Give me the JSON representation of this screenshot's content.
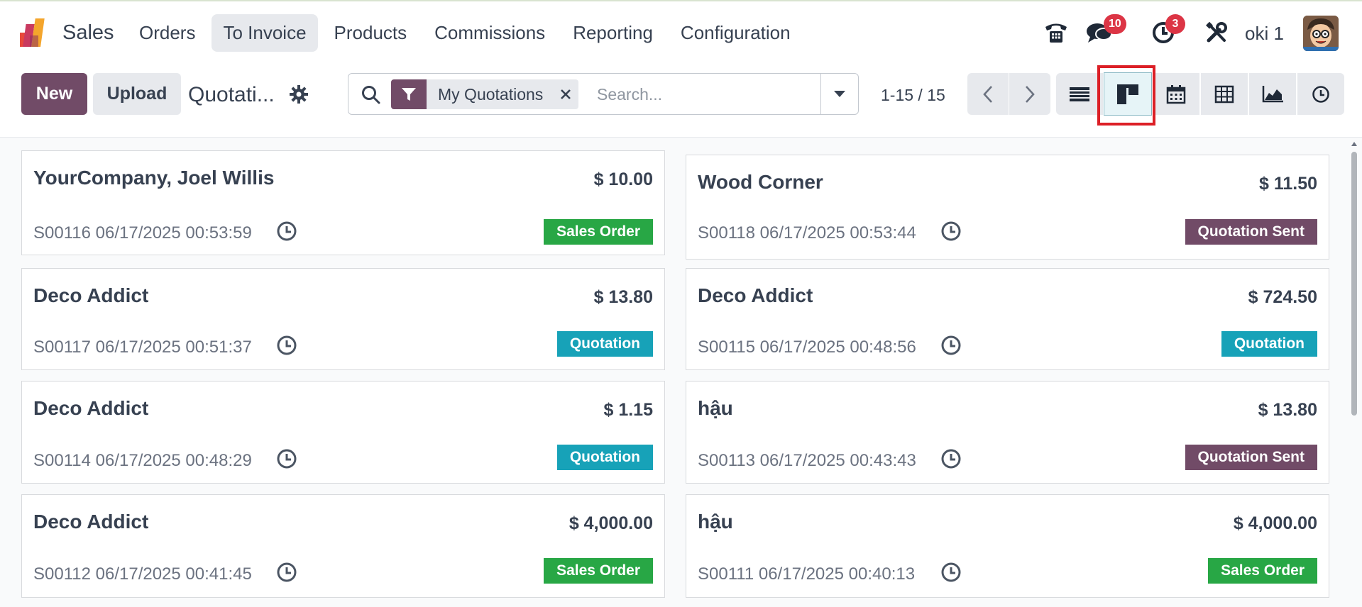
{
  "app": {
    "name": "Sales"
  },
  "menu": [
    {
      "label": "Orders",
      "active": false
    },
    {
      "label": "To Invoice",
      "active": true
    },
    {
      "label": "Products",
      "active": false
    },
    {
      "label": "Commissions",
      "active": false
    },
    {
      "label": "Reporting",
      "active": false
    },
    {
      "label": "Configuration",
      "active": false
    }
  ],
  "systray": {
    "messages_count": "10",
    "activities_count": "3",
    "user_name": "oki 1"
  },
  "control": {
    "new_label": "New",
    "upload_label": "Upload",
    "breadcrumb": "Quotati...",
    "search": {
      "facet_label": "My Quotations",
      "placeholder": "Search..."
    },
    "pager": "1-15 / 15",
    "views": [
      "list-icon",
      "kanban-icon",
      "calendar-icon",
      "pivot-icon",
      "graph-icon",
      "activity-icon"
    ],
    "active_view": "kanban-icon"
  },
  "colors": {
    "brand": "#714b67",
    "sales_order": "#28a745",
    "quotation": "#17a2b8",
    "quotation_sent": "#714b67",
    "highlight": "#dc1f26"
  },
  "cards": [
    {
      "name": "YourCompany, Joel Willis",
      "amount": "$ 10.00",
      "ref": "S00116 06/17/2025 00:53:59",
      "status": "Sales Order",
      "status_type": "order"
    },
    {
      "name": "Wood Corner",
      "amount": "$ 11.50",
      "ref": "S00118 06/17/2025 00:53:44",
      "status": "Quotation Sent",
      "status_type": "sent"
    },
    {
      "name": "Deco Addict",
      "amount": "$ 13.80",
      "ref": "S00117 06/17/2025 00:51:37",
      "status": "Quotation",
      "status_type": "quote"
    },
    {
      "name": "Deco Addict",
      "amount": "$ 724.50",
      "ref": "S00115 06/17/2025 00:48:56",
      "status": "Quotation",
      "status_type": "quote"
    },
    {
      "name": "Deco Addict",
      "amount": "$ 1.15",
      "ref": "S00114 06/17/2025 00:48:29",
      "status": "Quotation",
      "status_type": "quote"
    },
    {
      "name": "hậu",
      "amount": "$ 13.80",
      "ref": "S00113 06/17/2025 00:43:43",
      "status": "Quotation Sent",
      "status_type": "sent"
    },
    {
      "name": "Deco Addict",
      "amount": "$ 4,000.00",
      "ref": "S00112 06/17/2025 00:41:45",
      "status": "Sales Order",
      "status_type": "order"
    },
    {
      "name": "hậu",
      "amount": "$ 4,000.00",
      "ref": "S00111 06/17/2025 00:40:13",
      "status": "Sales Order",
      "status_type": "order"
    }
  ]
}
